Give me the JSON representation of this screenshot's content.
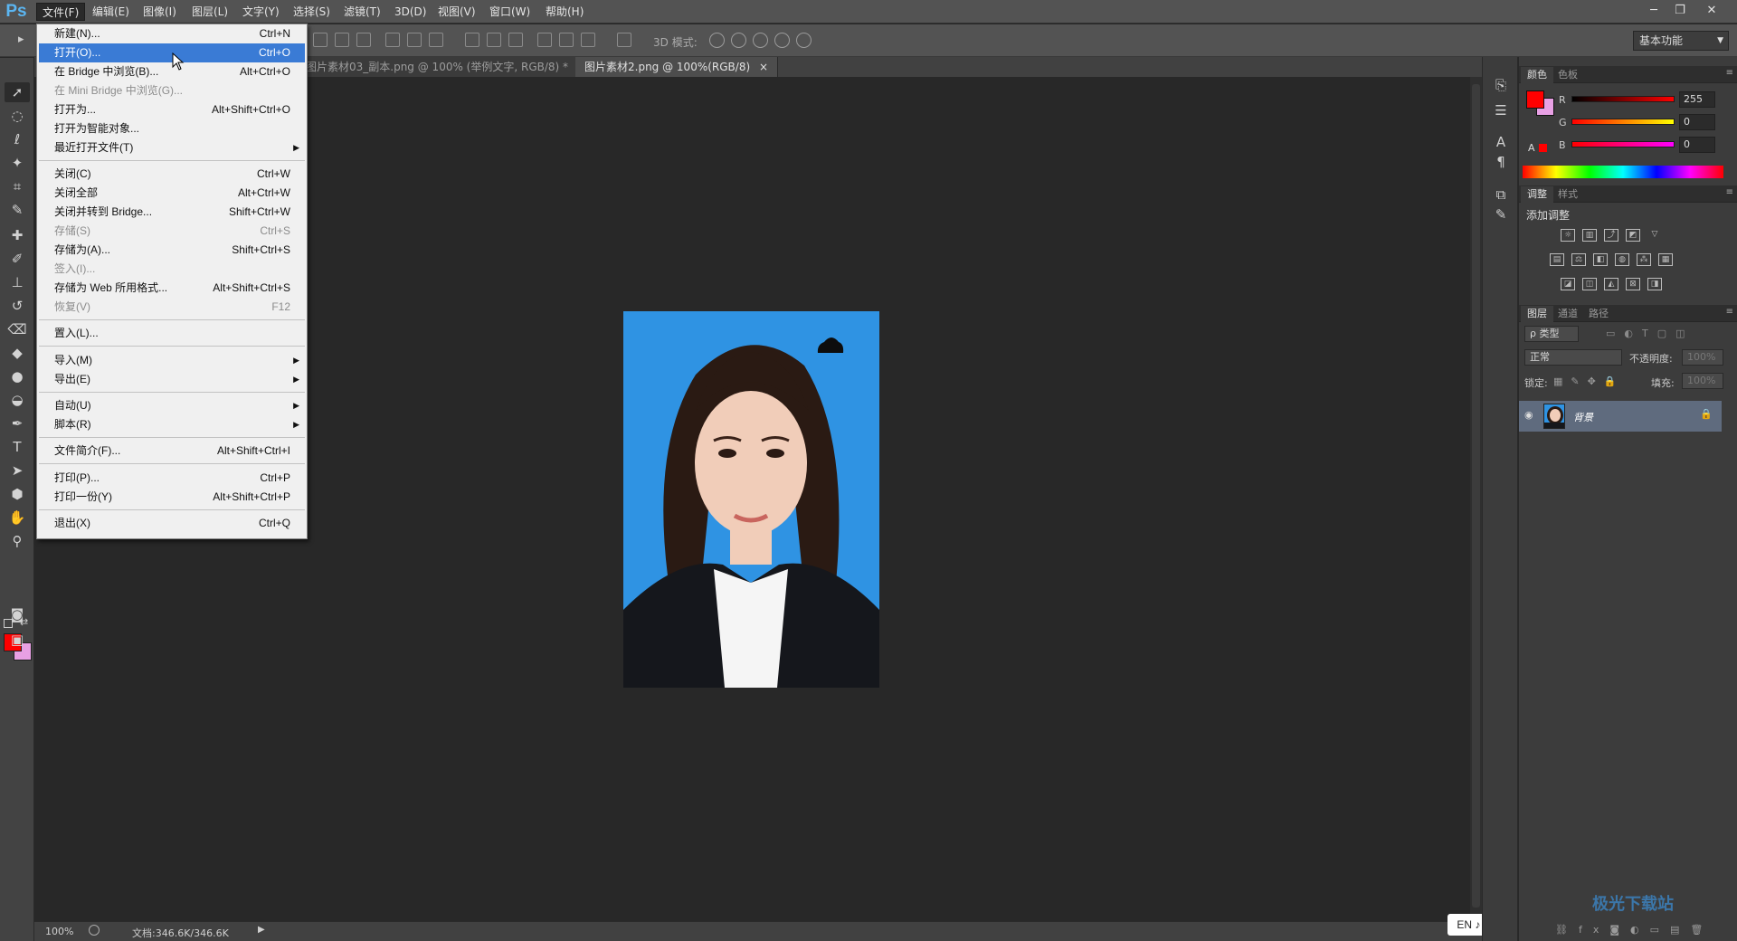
{
  "app": {
    "logo": "Ps"
  },
  "menubar": {
    "items": [
      "文件(F)",
      "编辑(E)",
      "图像(I)",
      "图层(L)",
      "文字(Y)",
      "选择(S)",
      "滤镜(T)",
      "3D(D)",
      "视图(V)",
      "窗口(W)",
      "帮助(H)"
    ],
    "window_controls": [
      "─",
      "❐",
      "✕"
    ]
  },
  "options": {
    "mode_label": "3D 模式:",
    "workspace": "基本功能"
  },
  "tabs": [
    {
      "label": "图片素材03_副本.png @ 100% (举例文字, RGB/8) *",
      "close": "×"
    },
    {
      "label": "图片素材2.png @ 100%(RGB/8)",
      "close": "×"
    }
  ],
  "status": {
    "zoom": "100%",
    "doc": "文档:346.6K/346.6K",
    "arrow": "▶"
  },
  "ime": "EN ♪ 简",
  "file_menu": {
    "items": [
      {
        "label": "新建(N)...",
        "shortcut": "Ctrl+N"
      },
      {
        "label": "打开(O)...",
        "shortcut": "Ctrl+O"
      },
      {
        "label": "在 Bridge 中浏览(B)...",
        "shortcut": "Alt+Ctrl+O"
      },
      {
        "label": "在 Mini Bridge 中浏览(G)...",
        "shortcut": ""
      },
      {
        "label": "打开为...",
        "shortcut": "Alt+Shift+Ctrl+O"
      },
      {
        "label": "打开为智能对象...",
        "shortcut": ""
      },
      {
        "label": "最近打开文件(T)",
        "shortcut": ""
      },
      {
        "label": "关闭(C)",
        "shortcut": "Ctrl+W"
      },
      {
        "label": "关闭全部",
        "shortcut": "Alt+Ctrl+W"
      },
      {
        "label": "关闭并转到 Bridge...",
        "shortcut": "Shift+Ctrl+W"
      },
      {
        "label": "存储(S)",
        "shortcut": "Ctrl+S"
      },
      {
        "label": "存储为(A)...",
        "shortcut": "Shift+Ctrl+S"
      },
      {
        "label": "签入(I)...",
        "shortcut": ""
      },
      {
        "label": "存储为 Web 所用格式...",
        "shortcut": "Alt+Shift+Ctrl+S"
      },
      {
        "label": "恢复(V)",
        "shortcut": "F12"
      },
      {
        "label": "置入(L)...",
        "shortcut": ""
      },
      {
        "label": "导入(M)",
        "shortcut": ""
      },
      {
        "label": "导出(E)",
        "shortcut": ""
      },
      {
        "label": "自动(U)",
        "shortcut": ""
      },
      {
        "label": "脚本(R)",
        "shortcut": ""
      },
      {
        "label": "文件简介(F)...",
        "shortcut": "Alt+Shift+Ctrl+I"
      },
      {
        "label": "打印(P)...",
        "shortcut": "Ctrl+P"
      },
      {
        "label": "打印一份(Y)",
        "shortcut": "Alt+Shift+Ctrl+P"
      },
      {
        "label": "退出(X)",
        "shortcut": "Ctrl+Q"
      }
    ]
  },
  "color_panel": {
    "tabs": [
      "颜色",
      "色板"
    ],
    "r_label": "R",
    "g_label": "G",
    "b_label": "B",
    "r": "255",
    "g": "0",
    "b": "0",
    "foreground": "#ff0000",
    "background": "#e8a0e4"
  },
  "adjust_panel": {
    "tabs": [
      "调整",
      "样式"
    ],
    "title": "添加调整"
  },
  "layers_panel": {
    "tabs": [
      "图层",
      "通道",
      "路径"
    ],
    "filter": "ρ 类型",
    "blend": "正常",
    "opacity_label": "不透明度:",
    "opacity": "100%",
    "lock_label": "锁定:",
    "fill_label": "填充:",
    "fill": "100%",
    "layer_name": "背景"
  },
  "watermark": "极光下载站"
}
